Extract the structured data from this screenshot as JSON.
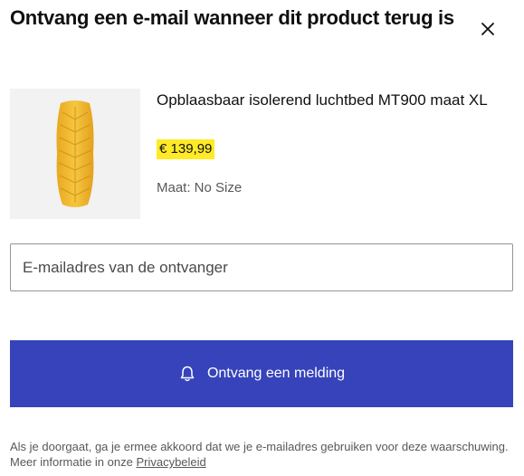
{
  "dialog": {
    "title": "Ontvang een e-mail wanneer dit product terug is",
    "close_icon": "close-icon"
  },
  "product": {
    "name": "Opblaasbaar isolerend luchtbed MT900 maat XL",
    "price": "€ 139,99",
    "size_text": "Maat: No Size",
    "image_icon": "sleeping-mat-image"
  },
  "form": {
    "email_placeholder": "E-mailadres van de ontvanger",
    "email_value": ""
  },
  "action": {
    "button_label": "Ontvang een melding",
    "button_icon": "bell-icon"
  },
  "disclaimer": {
    "text": "Als je doorgaat, ga je ermee akkoord dat we je e-mailadres gebruiken voor deze waarschuwing. Meer informatie in onze ",
    "link_label": "Privacybeleid"
  },
  "colors": {
    "accent": "#3643ba",
    "price_highlight": "#ffea28",
    "mat_yellow": "#f2b92e"
  }
}
